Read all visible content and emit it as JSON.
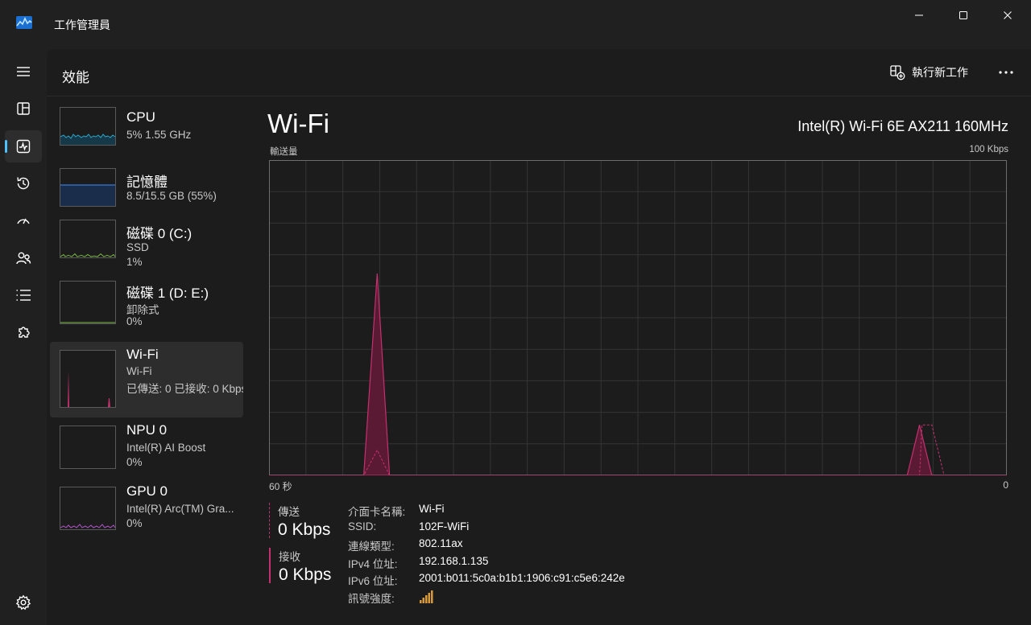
{
  "window": {
    "title": "工作管理員"
  },
  "header": {
    "title": "效能",
    "run_new_task": "執行新工作"
  },
  "devices": [
    {
      "name": "CPU",
      "sub1": "5% 1.55 GHz",
      "sub2": ""
    },
    {
      "name": "記憶體",
      "sub1": "8.5/15.5 GB (55%)",
      "sub2": ""
    },
    {
      "name": "磁碟 0 (C:)",
      "sub1": "SSD",
      "sub2": "1%"
    },
    {
      "name": "磁碟 1 (D: E:)",
      "sub1": "卸除式",
      "sub2": "0%"
    },
    {
      "name": "Wi-Fi",
      "sub1": "Wi-Fi",
      "sub2": "已傳送: 0 已接收: 0 Kbps"
    },
    {
      "name": "NPU 0",
      "sub1": "Intel(R) AI Boost",
      "sub2": "0%"
    },
    {
      "name": "GPU 0",
      "sub1": "Intel(R) Arc(TM) Gra...",
      "sub2": "0%"
    }
  ],
  "detail": {
    "title": "Wi-Fi",
    "adapter": "Intel(R) Wi-Fi 6E AX211 160MHz",
    "graph_label": "輸送量",
    "graph_max": "100 Kbps",
    "time_left": "60 秒",
    "time_right": "0",
    "send_label": "傳送",
    "send_value": "0 Kbps",
    "recv_label": "接收",
    "recv_value": "0 Kbps",
    "props": [
      {
        "k": "介面卡名稱:",
        "v": "Wi-Fi"
      },
      {
        "k": "SSID:",
        "v": "102F-WiFi"
      },
      {
        "k": "連線類型:",
        "v": "802.11ax"
      },
      {
        "k": "IPv4 位址:",
        "v": "192.168.1.135"
      },
      {
        "k": "IPv6 位址:",
        "v": "2001:b011:5c0a:b1b1:1906:c91:c5e6:242e"
      },
      {
        "k": "訊號強度:",
        "v": ""
      }
    ]
  },
  "colors": {
    "accent": "#4cc2ff",
    "wifi": "#c5306f",
    "cpu": "#2ca6c8",
    "mem": "#3a78d8",
    "disk": "#7bc144",
    "gpu": "#b054c8"
  },
  "throughput": {
    "unit": "Kbps",
    "max": 100,
    "received": [
      {
        "t": 60,
        "v": 0
      },
      {
        "t": 52.3,
        "v": 0
      },
      {
        "t": 51.2,
        "v": 64
      },
      {
        "t": 50.2,
        "v": 0
      },
      {
        "t": 8.1,
        "v": 0
      },
      {
        "t": 7.1,
        "v": 16
      },
      {
        "t": 6.1,
        "v": 0
      },
      {
        "t": 0,
        "v": 0
      }
    ],
    "sent": [
      {
        "t": 60,
        "v": 0
      },
      {
        "t": 52.3,
        "v": 0
      },
      {
        "t": 51.2,
        "v": 8
      },
      {
        "t": 50.2,
        "v": 0
      },
      {
        "t": 7.1,
        "v": 0
      },
      {
        "t": 6.9,
        "v": 16
      },
      {
        "t": 6.1,
        "v": 16
      },
      {
        "t": 5.1,
        "v": 0
      },
      {
        "t": 0,
        "v": 0
      }
    ]
  }
}
